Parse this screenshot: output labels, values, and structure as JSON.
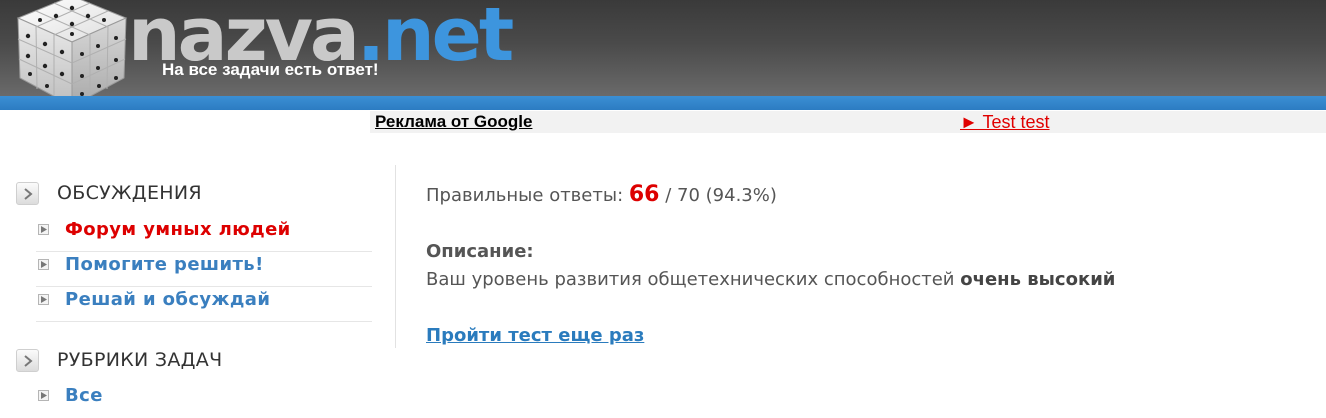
{
  "header": {
    "logo_part1": "nazva",
    "logo_part2": ".net",
    "tagline": "На все задачи есть ответ!"
  },
  "ad_bar": {
    "label": "Реклама от Google",
    "link": "► Test test"
  },
  "sidebar": {
    "sections": [
      {
        "title": "ОБСУЖДЕНИЯ",
        "items": [
          {
            "label": "Форум умных людей",
            "active": true
          },
          {
            "label": "Помогите решить!",
            "active": false
          },
          {
            "label": "Решай и обсуждай",
            "active": false
          }
        ]
      },
      {
        "title": "РУБРИКИ ЗАДАЧ",
        "items": [
          {
            "label": "Все",
            "active": false
          }
        ]
      }
    ]
  },
  "result": {
    "correct_label": "Правильные ответы:",
    "correct_value": "66",
    "total_text": "/ 70 (94.3%)",
    "description_heading": "Описание:",
    "description_text": "Ваш уровень развития общетехнических способностей",
    "description_emphasis": "очень высокий",
    "retry_link": "Пройти тест еще раз"
  },
  "colors": {
    "accent_blue": "#3d95de",
    "link_blue": "#3a7fbf",
    "active_red": "#dd0000",
    "header_dark": "#3a3a3a"
  }
}
